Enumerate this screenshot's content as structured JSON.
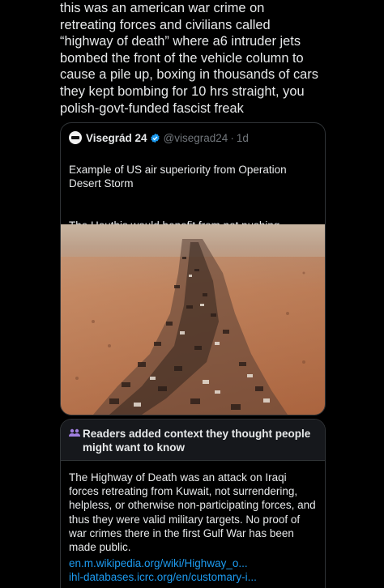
{
  "reply": {
    "text": "this was an american war crime on\nretreating forces and civilians called\n“highway of death” where a6 intruder jets\nbombed the front of the vehicle column to\ncause a pile up, boxing in thousands of cars\nthey kept bombing for 10 hrs straight, you\npolish-govt-funded fascist freak"
  },
  "quote": {
    "display_name": "Visegrád 24",
    "handle": "@visegrad24",
    "separator": "·",
    "time": "1d",
    "avatar_icon": "visegrad-logo-icon",
    "verified_icon": "verified-badge-icon",
    "verified_color": "#1d9bf0",
    "text_1": "Example of US air superiority from Operation\nDesert Storm",
    "text_2": "The Houthis would benefit from not pushing\nbuttons"
  },
  "community_note": {
    "icon": "people-icon",
    "title": "Readers added context they thought people might want to know",
    "body": "The Highway of Death was an attack on Iraqi forces retreating from Kuwait, not surrendering, helpless, or otherwise non-participating forces, and thus they were valid military targets. No proof of war crimes there in the first Gulf War has been made public.",
    "links": [
      "en.m.wikipedia.org/wiki/Highway_o...",
      "ihl-databases.icrc.org/en/customary-i..."
    ],
    "link_color": "#1d9bf0"
  }
}
